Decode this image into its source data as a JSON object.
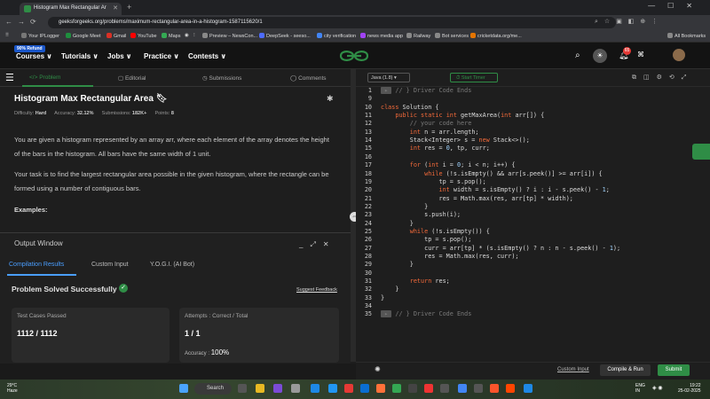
{
  "browser": {
    "tab_title": "Histogram Max Rectangular Ar",
    "url": "geeksforgeeks.org/problems/maximum-rectangular-area-in-a-histogram-1587115620/1",
    "bookmarks": [
      "Your IPLogger",
      "Google Meet",
      "Gmail",
      "YouTube",
      "Maps",
      "Preview – NewsCon...",
      "DeepSeek - seeso...",
      "city verification",
      "news media app",
      "Railway",
      "Bot services",
      "cricketdata.org/me..."
    ],
    "all_bookmarks": "All Bookmarks"
  },
  "site_nav": {
    "refund_badge": "90% Refund",
    "menus": [
      "Courses ∨",
      "Tutorials ∨",
      "Jobs ∨",
      "Practice ∨",
      "Contests ∨"
    ],
    "notification_count": "65"
  },
  "left_tabs": [
    "Problem",
    "Editorial",
    "Submissions",
    "Comments"
  ],
  "problem": {
    "title": "Histogram Max Rectangular Area",
    "difficulty_label": "Difficulty:",
    "difficulty": "Hard",
    "accuracy_label": "Accuracy:",
    "accuracy": "32.12%",
    "submissions_label": "Submissions:",
    "submissions": "182K+",
    "points_label": "Points:",
    "points": "8",
    "para1": "You are given a histogram represented by an array arr, where each element of the array denotes the height of the bars in the histogram. All bars have the same width of 1 unit.",
    "para2": "Your task is to find the largest rectangular area possible in the given histogram, where the rectangle can be formed using a number of contiguous bars.",
    "examples": "Examples:"
  },
  "output_window": {
    "title": "Output Window",
    "tabs": [
      "Compilation Results",
      "Custom Input",
      "Y.O.G.I. (AI Bot)"
    ],
    "status": "Problem Solved Successfully",
    "feedback": "Suggest Feedback",
    "tests_label": "Test Cases Passed",
    "tests_value": "1112 / 1112",
    "attempts_label": "Attempts : Correct / Total",
    "attempts_value": "1 / 1",
    "accuracy_label": "Accuracy :",
    "accuracy_value": "100%"
  },
  "editor": {
    "language": "Java (1.8)",
    "timer": "Start Timer",
    "line_numbers": [
      "1",
      "9",
      "10",
      "11",
      "12",
      "13",
      "14",
      "15",
      "16",
      "17",
      "18",
      "19",
      "20",
      "21",
      "22",
      "23",
      "24",
      "25",
      "26",
      "27",
      "28",
      "29",
      "30",
      "31",
      "32",
      "33",
      "34",
      "35"
    ],
    "lines": [
      "// } Driver Code Ends",
      "",
      "class Solution {",
      "    public static int getMaxArea(int arr[]) {",
      "        // your code here",
      "        int n = arr.length;",
      "        Stack<Integer> s = new Stack<>();",
      "        int res = 0, tp, curr;",
      "",
      "        for (int i = 0; i < n; i++) {",
      "            while (!s.isEmpty() && arr[s.peek()] >= arr[i]) {",
      "                tp = s.pop();",
      "                int width = s.isEmpty() ? i : i - s.peek() - 1;",
      "                res = Math.max(res, arr[tp] * width);",
      "            }",
      "            s.push(i);",
      "        }",
      "        while (!s.isEmpty()) {",
      "            tp = s.pop();",
      "            curr = arr[tp] * (s.isEmpty() ? n : n - s.peek() - 1);",
      "            res = Math.max(res, curr);",
      "        }",
      "",
      "        return res;",
      "    }",
      "}",
      "",
      "// } Driver Code Ends"
    ],
    "custom_input": "Custom Input",
    "compile_run": "Compile & Run",
    "submit": "Submit"
  },
  "taskbar": {
    "weather_temp": "29°C",
    "weather_desc": "Haze",
    "search": "Search",
    "lang": "ENG",
    "lang2": "IN",
    "time": "19:22",
    "date": "25-02-2025"
  },
  "colors": {
    "accent_green": "#2f8d46",
    "link_blue": "#4a9eff"
  }
}
